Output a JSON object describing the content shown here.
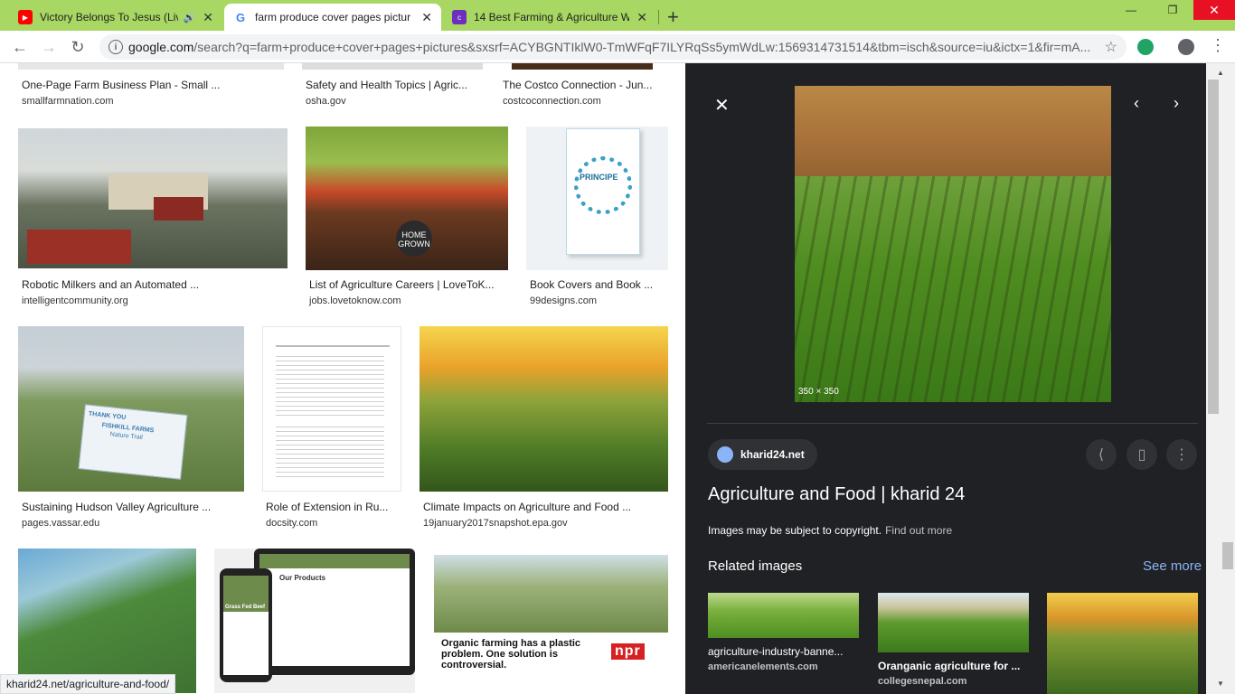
{
  "tabs": [
    {
      "title": "Victory Belongs To Jesus (Liv",
      "favicon": "youtube-icon",
      "color": "#ff0000"
    },
    {
      "title": "farm produce cover pages pictur",
      "favicon": "google-icon",
      "color": "#4285f4"
    },
    {
      "title": "14 Best Farming & Agriculture W",
      "favicon": "colorlib-icon",
      "color": "#6c2fbd"
    }
  ],
  "omnibox": {
    "domain": "google.com",
    "path": "/search?q=farm+produce+cover+pages+pictures&sxsrf=ACYBGNTIklW0-TmWFqF7ILYRqSs5ymWdLw:1569314731514&tbm=isch&source=iu&ictx=1&fir=mA..."
  },
  "results": [
    {
      "caption": "One-Page Farm Business Plan - Small ...",
      "source": "smallfarmnation.com"
    },
    {
      "caption": "Safety and Health Topics | Agric...",
      "source": "osha.gov"
    },
    {
      "caption": "The Costco Connection - Jun...",
      "source": "costcoconnection.com"
    },
    {
      "caption": "Robotic Milkers and an Automated ...",
      "source": "intelligentcommunity.org"
    },
    {
      "caption": "List of Agriculture Careers | LoveToK...",
      "source": "jobs.lovetoknow.com"
    },
    {
      "caption": "Book Covers and Book ...",
      "source": "99designs.com"
    },
    {
      "caption": "Sustaining Hudson Valley Agriculture ...",
      "source": "pages.vassar.edu"
    },
    {
      "caption": "Role of Extension in Ru...",
      "source": "docsity.com"
    },
    {
      "caption": "Climate Impacts on Agriculture and Food ...",
      "source": "19january2017snapshot.epa.gov"
    }
  ],
  "thumb_text": {
    "sign": "THANK YOU",
    "sign_farm": "FISHKILL FARMS",
    "sign_trail": "Nature Trail",
    "chalk": "HOME GROWN",
    "book_title": "PRINCIPE",
    "npr_headline": "Organic farming has a plastic problem. One solution is controversial.",
    "npr_logo": "npr",
    "products": "Our Products",
    "grass": "Grass Fed Beef"
  },
  "panel": {
    "dimensions": "350 × 350",
    "site": "kharid24.net",
    "title": "Agriculture and Food | kharid 24",
    "copyright": "Images may be subject to copyright.",
    "find_out_more": "Find out more",
    "related": "Related images",
    "see_more": "See more",
    "related_items": [
      {
        "caption": "agriculture-industry-banne...",
        "source": "americanelements.com"
      },
      {
        "caption": "Oranganic agriculture for ...",
        "source": "collegesnepal.com"
      }
    ]
  },
  "status_url": "kharid24.net/agriculture-and-food/",
  "colors": {
    "tabstrip": "#a8d763",
    "panel_bg": "#202124",
    "link_blue": "#8ab4f8"
  }
}
